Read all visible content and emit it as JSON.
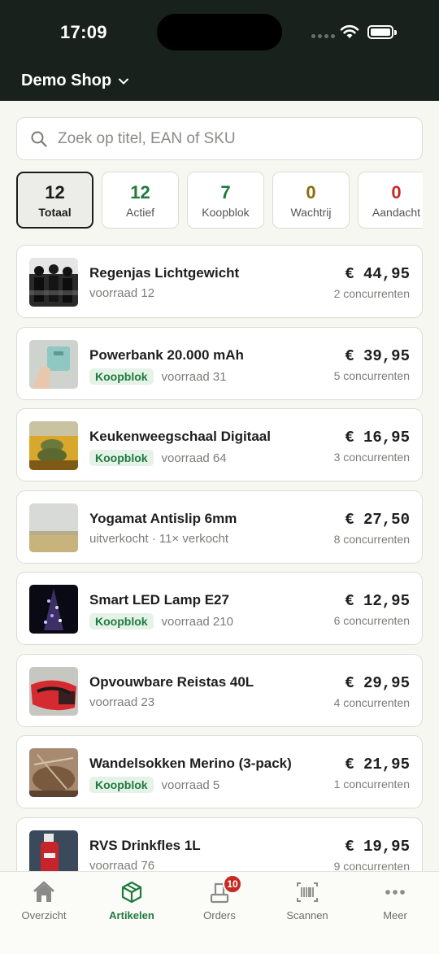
{
  "status": {
    "time": "17:09"
  },
  "header": {
    "shop_name": "Demo Shop"
  },
  "search": {
    "placeholder": "Zoek op titel, EAN of SKU"
  },
  "stats": [
    {
      "value": "12",
      "label": "Totaal",
      "color": "#1c1c1c"
    },
    {
      "value": "12",
      "label": "Actief",
      "color": "#1f7a3e"
    },
    {
      "value": "7",
      "label": "Koopblok",
      "color": "#1f7a3e"
    },
    {
      "value": "0",
      "label": "Wachtrij",
      "color": "#8a6d0b"
    },
    {
      "value": "0",
      "label": "Aandacht",
      "color": "#c62b23"
    }
  ],
  "products": [
    {
      "name": "Regenjas Lichtgewicht",
      "badge": "",
      "sub": "voorraad 12",
      "price": "€ 44,95",
      "competitors": "2 concurrenten"
    },
    {
      "name": "Powerbank 20.000 mAh",
      "badge": "Koopblok",
      "sub": "voorraad 31",
      "price": "€ 39,95",
      "competitors": "5 concurrenten"
    },
    {
      "name": "Keukenweegschaal Digitaal",
      "badge": "Koopblok",
      "sub": "voorraad 64",
      "price": "€ 16,95",
      "competitors": "3 concurrenten"
    },
    {
      "name": "Yogamat Antislip 6mm",
      "badge": "",
      "sub": "uitverkocht · 11× verkocht",
      "price": "€ 27,50",
      "competitors": "8 concurrenten"
    },
    {
      "name": "Smart LED Lamp E27",
      "badge": "Koopblok",
      "sub": "voorraad 210",
      "price": "€ 12,95",
      "competitors": "6 concurrenten"
    },
    {
      "name": "Opvouwbare Reistas 40L",
      "badge": "",
      "sub": "voorraad 23",
      "price": "€ 29,95",
      "competitors": "4 concurrenten"
    },
    {
      "name": "Wandelsokken Merino (3-pack)",
      "badge": "Koopblok",
      "sub": "voorraad 5",
      "price": "€ 21,95",
      "competitors": "1 concurrenten"
    },
    {
      "name": "RVS Drinkfles 1L",
      "badge": "",
      "sub": "voorraad 76",
      "price": "€ 19,95",
      "competitors": "9 concurrenten"
    }
  ],
  "tabs": [
    {
      "label": "Overzicht",
      "icon": "home-icon"
    },
    {
      "label": "Artikelen",
      "icon": "box-icon"
    },
    {
      "label": "Orders",
      "icon": "orders-icon",
      "badge": "10"
    },
    {
      "label": "Scannen",
      "icon": "barcode-icon"
    },
    {
      "label": "Meer",
      "icon": "more-icon"
    }
  ],
  "colors": {
    "accent": "#1f7a3e",
    "header_bg": "#18211c",
    "danger": "#c62b23"
  }
}
